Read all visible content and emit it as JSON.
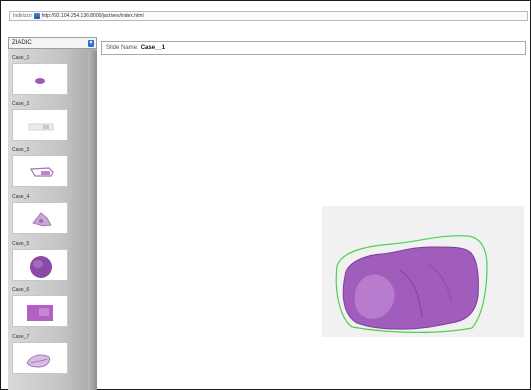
{
  "browser": {
    "address_label": "Indirizzo",
    "url": "http://92.104.254.136:8000/jactivex/index.html"
  },
  "sidebar": {
    "dropdown": {
      "selected": "ZIADIC"
    },
    "cases": [
      {
        "label": "Case_1",
        "thumb_color": "#9c5ab8"
      },
      {
        "label": "Case_2",
        "thumb_color": "#b7b7b7"
      },
      {
        "label": "Case_3",
        "thumb_color": "#a473b6"
      },
      {
        "label": "Case_4",
        "thumb_color": "#9d68b4"
      },
      {
        "label": "Case_5",
        "thumb_color": "#8c4aa8"
      },
      {
        "label": "Case_6",
        "thumb_color": "#b35fc4"
      },
      {
        "label": "Case_7",
        "thumb_color": "#a06cb5"
      }
    ]
  },
  "main": {
    "slide_name_label": "Slide Name:",
    "slide_name_value": "Case__1",
    "tissue_color": "#a05dbb",
    "annotation_color": "#4dd14d"
  }
}
